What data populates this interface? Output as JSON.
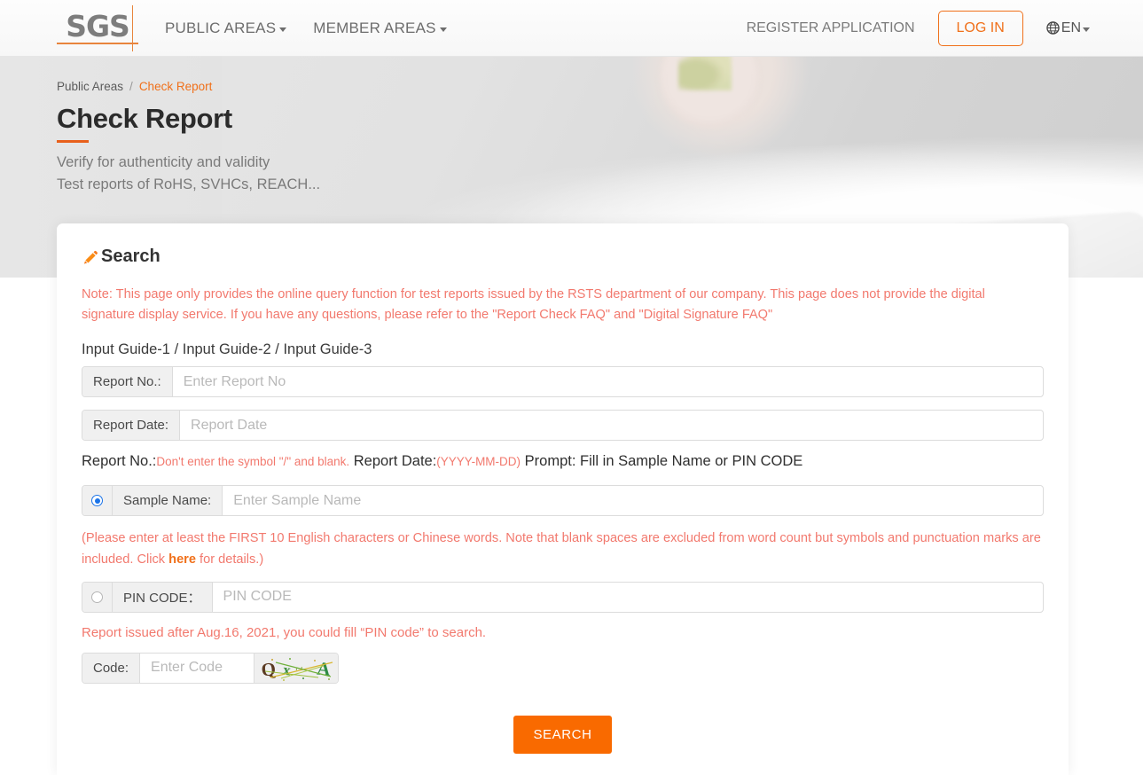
{
  "header": {
    "logo_text": "SGS",
    "nav": [
      {
        "label": "PUBLIC AREAS",
        "has_caret": true
      },
      {
        "label": "MEMBER AREAS",
        "has_caret": true
      }
    ],
    "register_label": "REGISTER APPLICATION",
    "login_label": "LOG IN",
    "language": "EN",
    "globe_icon": "globe-icon",
    "caret_icon": "caret-down-icon"
  },
  "hero": {
    "breadcrumb_home": "Public Areas",
    "breadcrumb_sep": "/",
    "breadcrumb_current": "Check Report",
    "title": "Check Report",
    "subtitle_line1": "Verify for authenticity and validity",
    "subtitle_line2": "Test reports of RoHS, SVHCs, REACH..."
  },
  "card": {
    "title": "Search",
    "title_icon": "pencil-icon",
    "note": "Note: This page only provides the online query function for test reports issued by the RSTS department of our company. This page does not provide the digital signature display service. If you have any questions, please refer to the \"Report Check FAQ\" and \"Digital Signature FAQ\"",
    "input_guide": "Input Guide-1 / Input Guide-2 / Input Guide-3",
    "report_no": {
      "label": "Report No.:",
      "value": "",
      "placeholder": "Enter Report No"
    },
    "report_date": {
      "label": "Report Date:",
      "value": "",
      "placeholder": "Report Date"
    },
    "prompt": {
      "part1": "Report No.:",
      "part2": "Don't enter the symbol \"/\" and blank.",
      "part3": "Report Date:",
      "part4": "(YYYY-MM-DD)",
      "part5": "Prompt: Fill in Sample Name or PIN CODE"
    },
    "sample_name": {
      "label": "Sample Name:",
      "value": "",
      "placeholder": "Enter Sample Name",
      "selected": true
    },
    "sample_hint_before": "(Please enter at least the FIRST 10 English characters or Chinese words. Note that blank spaces are excluded from word count but symbols and punctuation marks are included. Click ",
    "sample_hint_link": "here",
    "sample_hint_after": " for details.)",
    "pin_code": {
      "label": "PIN CODE：",
      "value": "",
      "placeholder": "PIN CODE",
      "selected": false
    },
    "pin_hint": "Report issued after Aug.16, 2021, you could fill  “PIN code”  to search.",
    "code": {
      "label": "Code:",
      "value": "",
      "placeholder": "Enter Code",
      "captcha_text": "Q A",
      "captcha_alt": "captcha-image"
    },
    "search_button": "SEARCH"
  },
  "colors": {
    "accent_orange": "#f0701a",
    "button_orange": "#f96a00",
    "note_red": "#f2796e",
    "radio_blue": "#1a73e8",
    "logo_gray": "#7d7d7d"
  }
}
